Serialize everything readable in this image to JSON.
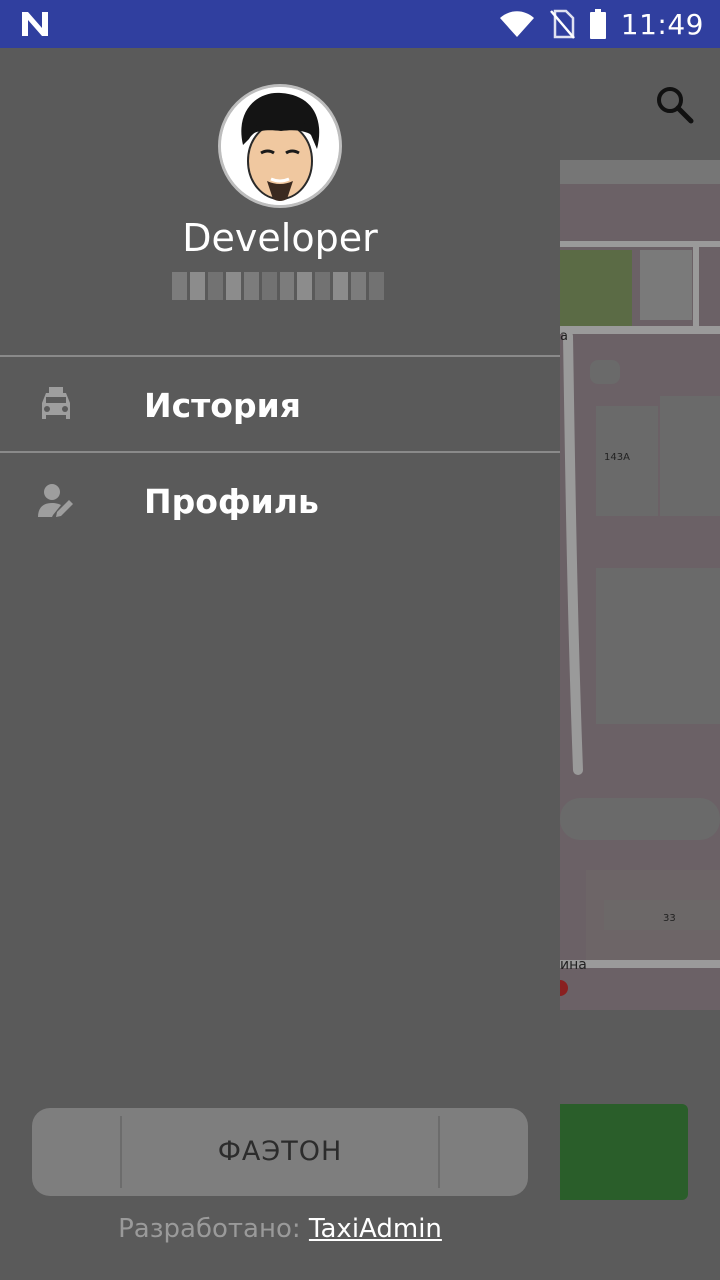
{
  "status_bar": {
    "time": "11:49",
    "icons": [
      "notification-n-icon",
      "wifi-icon",
      "no-sim-icon",
      "battery-icon"
    ]
  },
  "map": {
    "labels": [
      "143A",
      "33",
      "а",
      "ина"
    ]
  },
  "drawer": {
    "user_name": "Developer",
    "menu": [
      {
        "label": "История",
        "icon": "taxi-car-icon"
      },
      {
        "label": "Профиль",
        "icon": "person-edit-icon"
      }
    ],
    "brand": "ФАЭТОН",
    "credit_prefix": "Разработано: ",
    "credit_link": "TaxiAdmin"
  },
  "colors": {
    "status_bar": "#303f9f",
    "drawer_bg": "#5a5a5a",
    "accent_green": "#2a5e2a"
  }
}
